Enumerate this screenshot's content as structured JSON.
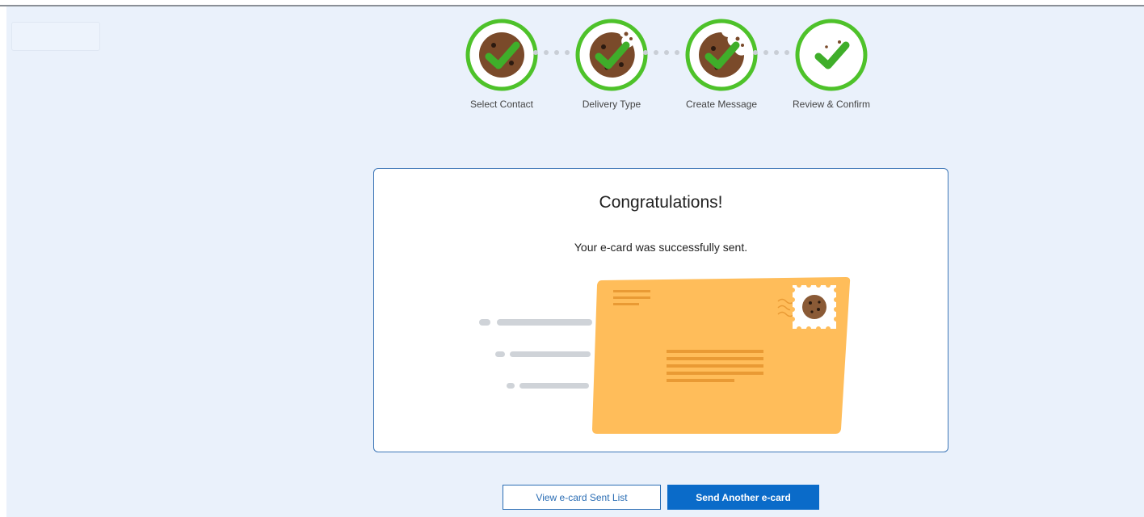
{
  "steps": [
    {
      "label": "Select Contact",
      "icon": "cookie-check-icon"
    },
    {
      "label": "Delivery Type",
      "icon": "cookie-check-icon"
    },
    {
      "label": "Create Message",
      "icon": "cookie-check-icon"
    },
    {
      "label": "Review & Confirm",
      "icon": "cookie-check-icon"
    }
  ],
  "result": {
    "title": "Congratulations!",
    "message": "Your e-card was successfully sent.",
    "illustration": "envelope-illustration"
  },
  "actions": {
    "view_sent_list": "View e-card Sent List",
    "send_another": "Send Another e-card"
  },
  "colors": {
    "background": "#eaf1fb",
    "step_ring": "#4ec22a",
    "check": "#3fae2a",
    "cookie": "#7a4a2a",
    "envelope": "#ffbd5a",
    "primary": "#0a6bc9",
    "card_border": "#3d76b7"
  }
}
